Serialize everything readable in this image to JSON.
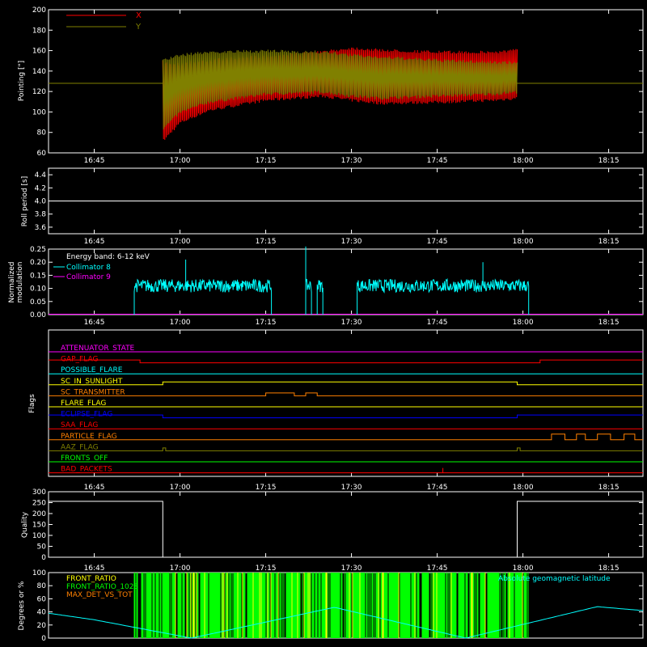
{
  "x_ticks": [
    "16:45",
    "17:00",
    "17:15",
    "17:30",
    "17:45",
    "18:00",
    "18:15"
  ],
  "x_tick_times": [
    "16:45",
    "17:00",
    "17:15",
    "17:30",
    "17:45",
    "18:00",
    "18:15"
  ],
  "x_range": [
    "16:37",
    "18:21"
  ],
  "colors": {
    "background": "#000000",
    "axes": "#ffffff",
    "pointing_x": "#ff0000",
    "pointing_y": "#808000",
    "roll": "#ffffff",
    "collimator_8": "#00ffff",
    "collimator_9": "#ff00ff",
    "quality": "#ffffff",
    "front_ratio": "#ffff00",
    "front_ratio_green": "#00ff00",
    "max_det": "#ff8000",
    "geomag": "#00ffff"
  },
  "chart_data": [
    {
      "type": "line",
      "id": "pointing",
      "ylabel": "Pointing [\"]",
      "ylim": [
        60,
        200
      ],
      "y_ticks": [
        "60",
        "80",
        "100",
        "120",
        "140",
        "160",
        "180",
        "200"
      ],
      "baseline_before_after": 128,
      "active_interval": [
        "16:57",
        "17:59"
      ],
      "series": [
        {
          "name": "X",
          "color": "#ff0000",
          "envelope_times": [
            "16:57",
            "17:00",
            "17:05",
            "17:15",
            "17:25",
            "17:30",
            "17:35",
            "17:45",
            "17:55",
            "17:59"
          ],
          "upper": [
            150,
            148,
            152,
            156,
            160,
            164,
            162,
            160,
            160,
            162
          ],
          "lower": [
            70,
            88,
            100,
            110,
            114,
            110,
            107,
            108,
            110,
            112
          ]
        },
        {
          "name": "Y",
          "color": "#808000",
          "envelope_times": [
            "16:57",
            "17:00",
            "17:05",
            "17:15",
            "17:25",
            "17:30",
            "17:35",
            "17:45",
            "17:55",
            "17:59"
          ],
          "upper": [
            152,
            157,
            160,
            161,
            160,
            157,
            155,
            152,
            150,
            150
          ],
          "lower": [
            82,
            98,
            108,
            116,
            118,
            114,
            112,
            114,
            116,
            118
          ]
        }
      ]
    },
    {
      "type": "line",
      "id": "roll",
      "ylabel": "Roll period [s]",
      "ylim": [
        3.5,
        4.5
      ],
      "y_ticks": [
        "3.6",
        "3.8",
        "4.0",
        "4.2",
        "4.4"
      ],
      "series": [
        {
          "color": "#ffffff",
          "constant": 4.0
        }
      ]
    },
    {
      "type": "line",
      "id": "modulation",
      "ylabel": "Normalized modulation",
      "ylim": [
        0,
        0.25
      ],
      "y_ticks": [
        "0.00",
        "0.05",
        "0.10",
        "0.15",
        "0.20",
        "0.25"
      ],
      "annotation": "Energy band: 6-12 keV",
      "series": [
        {
          "name": "Collimator 8",
          "color": "#00ffff",
          "mean": 0.11,
          "segments": [
            [
              "16:52",
              "17:16"
            ],
            [
              "17:22",
              "17:23"
            ],
            [
              "17:24",
              "17:25"
            ],
            [
              "17:31",
              "18:01"
            ]
          ],
          "spikes": [
            {
              "t": "17:22",
              "v": 0.26
            },
            {
              "t": "17:01",
              "v": 0.21
            },
            {
              "t": "17:53",
              "v": 0.2
            }
          ]
        },
        {
          "name": "Collimator 9",
          "color": "#ff00ff",
          "constant": 0
        }
      ]
    },
    {
      "type": "line",
      "id": "flags",
      "ylabel": "Flags",
      "flags": [
        {
          "name": "ATTENUATOR_STATE",
          "color": "#ff00ff",
          "changes": []
        },
        {
          "name": "GAP_FLAG",
          "color": "#ff0000",
          "changes": [
            "16:53",
            "18:03"
          ],
          "levels": [
            1,
            0,
            1
          ]
        },
        {
          "name": "POSSIBLE_FLARE",
          "color": "#00ffff",
          "changes": []
        },
        {
          "name": "SC_IN_SUNLIGHT",
          "color": "#ffff00",
          "changes": [
            "16:57",
            "17:59"
          ],
          "levels": [
            0,
            1,
            0
          ]
        },
        {
          "name": "SC_TRANSMITTER",
          "color": "#ff8000",
          "changes": [
            "17:15",
            "17:20",
            "17:22",
            "17:24",
            "17:31"
          ],
          "levels": [
            0,
            1,
            0,
            1,
            0
          ]
        },
        {
          "name": "FLARE_FLAG",
          "color": "#ffff00",
          "changes": []
        },
        {
          "name": "ECLIPSE_FLAG",
          "color": "#0000ff",
          "changes": [
            "16:57",
            "17:59"
          ],
          "levels": [
            1,
            0,
            1
          ]
        },
        {
          "name": "SAA_FLAG",
          "color": "#ff0000",
          "changes": []
        },
        {
          "name": "PARTICLE_FLAG",
          "color": "#ff8000",
          "changes": [
            "18:05",
            "18:21"
          ],
          "levels": [
            0,
            2
          ]
        },
        {
          "name": "AAZ_FLAG",
          "color": "#808000",
          "changes": [
            "16:57",
            "16:57.5",
            "17:59",
            "17:59.5"
          ],
          "levels": [
            0,
            1,
            0,
            1,
            0
          ]
        },
        {
          "name": "FRONTS_OFF",
          "color": "#00ff00",
          "changes": []
        },
        {
          "name": "BAD_PACKETS",
          "color": "#ff0000",
          "changes": [
            "17:46"
          ],
          "levels": [
            0,
            2
          ]
        }
      ]
    },
    {
      "type": "line",
      "id": "quality",
      "ylabel": "Quality",
      "ylim": [
        0,
        300
      ],
      "y_ticks": [
        "0",
        "50",
        "100",
        "150",
        "200",
        "250",
        "300"
      ],
      "series": [
        {
          "color": "#ffffff",
          "times": [
            "16:37",
            "16:57",
            "16:57",
            "17:59",
            "17:59",
            "18:21"
          ],
          "values": [
            256,
            256,
            0,
            0,
            256,
            256
          ]
        }
      ]
    },
    {
      "type": "line",
      "id": "ratios",
      "ylabel": "Degrees or %",
      "ylim": [
        0,
        100
      ],
      "y_ticks": [
        "0",
        "20",
        "40",
        "60",
        "80",
        "100"
      ],
      "series": [
        {
          "name": "FRONT_RATIO",
          "color": "#ffff00"
        },
        {
          "name": "FRONT_RATIO_1028",
          "color": "#00ff00",
          "interval": [
            "16:52",
            "18:01"
          ]
        },
        {
          "name": "MAX_DET_VS_TOT",
          "color": "#ff8000"
        },
        {
          "name": "Absolute geomagnetic latitude",
          "color": "#00ffff",
          "times": [
            "16:37",
            "16:45",
            "17:02",
            "17:27",
            "17:50",
            "18:13",
            "18:21"
          ],
          "values": [
            38,
            28,
            0,
            47,
            0,
            48,
            42
          ]
        }
      ]
    }
  ],
  "pointing_legend": {
    "x": "X",
    "y": "Y"
  },
  "roll_ylabel": "Roll period [s]",
  "modulation_ylabel_1": "Normalized",
  "modulation_ylabel_2": "modulation",
  "modulation_energy": "Energy band: 6-12 keV",
  "modulation_legend": {
    "c8": "Collimator 8",
    "c9": "Collimator 9"
  },
  "ratios_legend": {
    "front_ratio": "FRONT_RATIO",
    "front_ratio_1028": "FRONT_RATIO_1028",
    "max_det": "MAX_DET_VS_TOT",
    "geomag": "Absolute geomagnetic latitude"
  }
}
